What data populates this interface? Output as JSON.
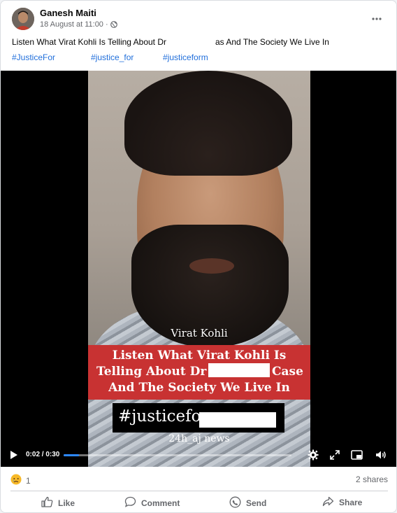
{
  "post": {
    "author": "Ganesh Maiti",
    "date": "18 August at 11:00",
    "separator": "·",
    "caption_start": "Listen What Virat Kohli Is Telling About Dr",
    "caption_end": "as And The Society We Live In",
    "hashtags": [
      "#JusticeFor",
      "#justice_for",
      "#justiceform"
    ]
  },
  "video": {
    "name_overlay": "Virat Kohli",
    "banner_lines": [
      "Listen What Virat Kohli Is",
      "Telling About Dr",
      "Case",
      "And The Society We Live In"
    ],
    "hashtag_overlay": "#justicefor",
    "source": "24h_aj news",
    "time": "0:02 / 0:30",
    "progress": 0.067
  },
  "stats": {
    "reaction_count": "1",
    "shares": "2 shares"
  },
  "actions": {
    "like": "Like",
    "comment": "Comment",
    "send": "Send",
    "share": "Share"
  },
  "colors": {
    "link": "#216fdb",
    "progress": "#2d88ff",
    "banner": "#c83232"
  },
  "icons": [
    "globe-icon",
    "more-icon",
    "play-icon",
    "settings-icon",
    "fullscreen-expand-icon",
    "miniplayer-icon",
    "volume-icon",
    "sad-reaction-icon",
    "like-icon",
    "comment-icon",
    "send-icon",
    "share-icon"
  ]
}
